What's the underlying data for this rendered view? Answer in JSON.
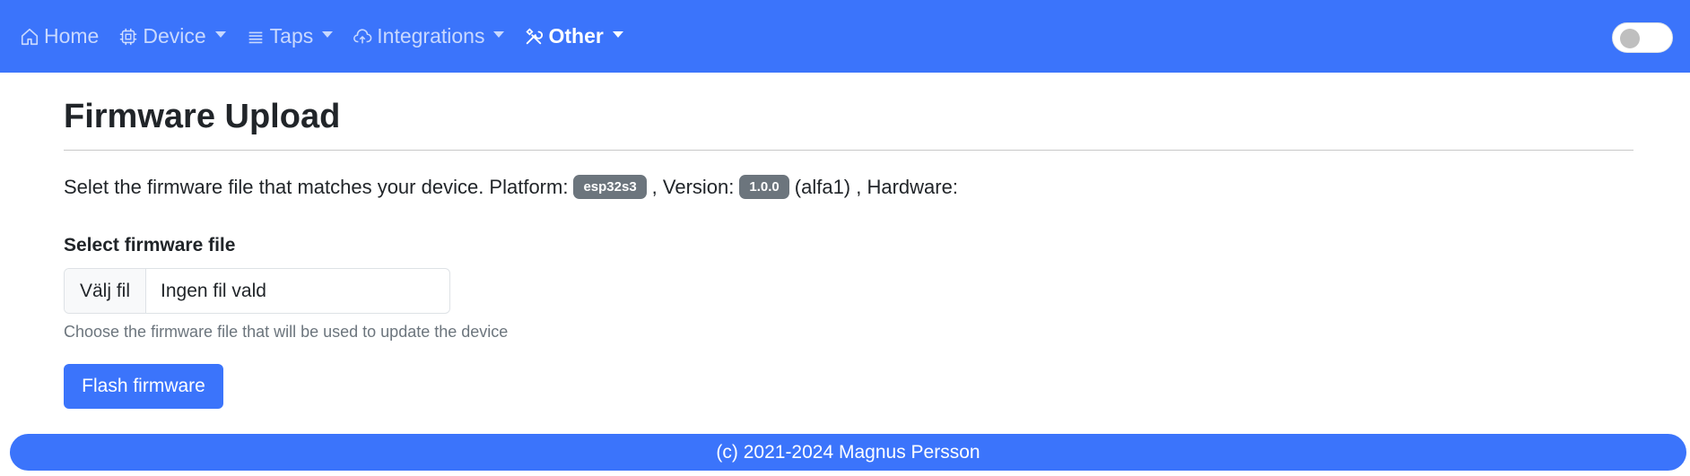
{
  "nav": {
    "items": [
      {
        "label": "Home",
        "icon": "house-icon",
        "dropdown": false,
        "active": false
      },
      {
        "label": "Device",
        "icon": "cpu-icon",
        "dropdown": true,
        "active": false
      },
      {
        "label": "Taps",
        "icon": "list-icon",
        "dropdown": true,
        "active": false
      },
      {
        "label": "Integrations",
        "icon": "cloud-upload-icon",
        "dropdown": true,
        "active": false
      },
      {
        "label": "Other",
        "icon": "tools-icon",
        "dropdown": true,
        "active": true
      }
    ],
    "theme_toggle": {
      "on": false
    }
  },
  "main": {
    "title": "Firmware Upload",
    "description": {
      "prefix": "Selet the firmware file that matches your device. Platform:",
      "platform": "esp32s3",
      "version_label": ", Version:",
      "version": "1.0.0",
      "version_suffix": "(alfa1) , Hardware:"
    },
    "form": {
      "label": "Select firmware file",
      "file_button": "Välj fil",
      "file_status": "Ingen fil vald",
      "help": "Choose the firmware file that will be used to update the device",
      "submit": "Flash firmware"
    }
  },
  "footer": {
    "text": "(c) 2021-2024 Magnus Persson"
  },
  "colors": {
    "primary": "#3b74fb",
    "badge": "#6c757d"
  }
}
